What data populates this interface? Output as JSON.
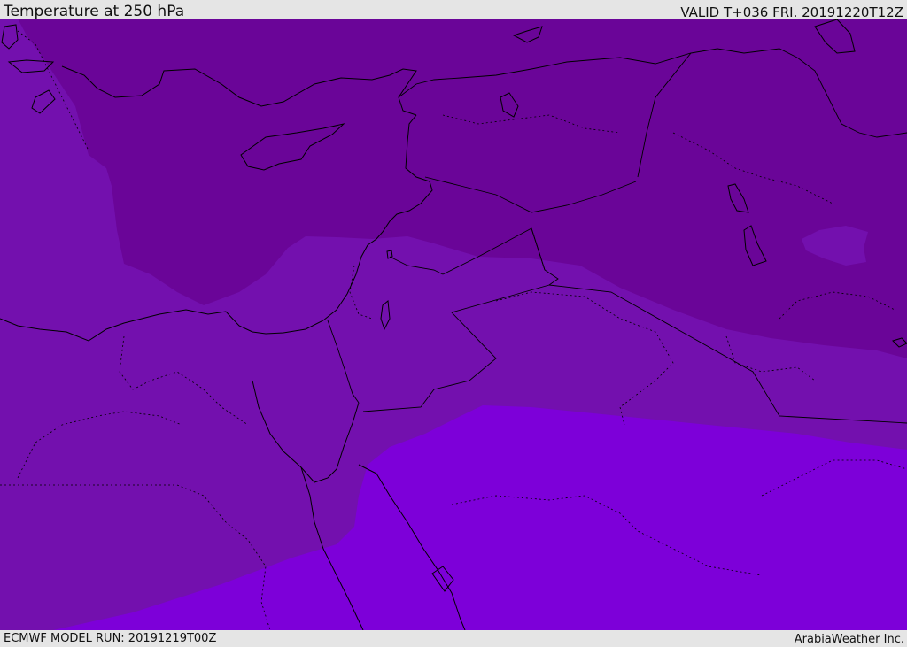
{
  "header": {
    "title": "Temperature at 250 hPa",
    "valid": "VALID T+036 FRI. 20191220T12Z"
  },
  "footer": {
    "model_run": "ECMWF MODEL RUN: 20191219T00Z",
    "credit": "ArabiaWeather Inc."
  },
  "map": {
    "colors": {
      "cold_band": "#6a0598",
      "mid_band": "#7310ae",
      "warm_band": "#7d00d9",
      "coastline": "#000000"
    }
  }
}
